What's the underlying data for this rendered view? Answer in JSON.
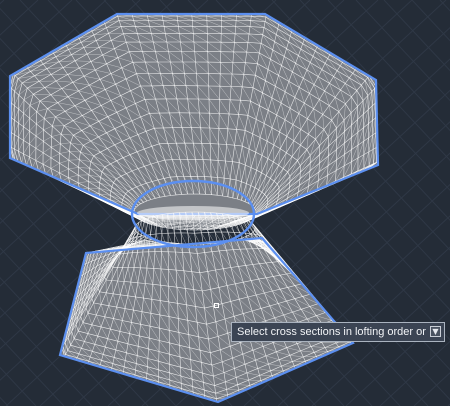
{
  "app": {
    "viewport_background": "#242c37",
    "grid_color": "#2f3846",
    "mesh_color": "#ffffff",
    "surface_color": "#7b7f86",
    "highlight_color": "#5b8ff0"
  },
  "objects": [
    {
      "name": "upper-octagon-cross-section",
      "shape": "octagon",
      "state": "highlighted"
    },
    {
      "name": "middle-ellipse-cross-section",
      "shape": "ellipse",
      "state": "highlighted"
    },
    {
      "name": "lower-pentagon-cross-section",
      "shape": "pentagon",
      "state": "highlighted"
    }
  ],
  "cursor": {
    "type": "pickbox",
    "prompt_text": "Select cross sections in lofting order or",
    "options_icon": "down-arrow-icon"
  }
}
